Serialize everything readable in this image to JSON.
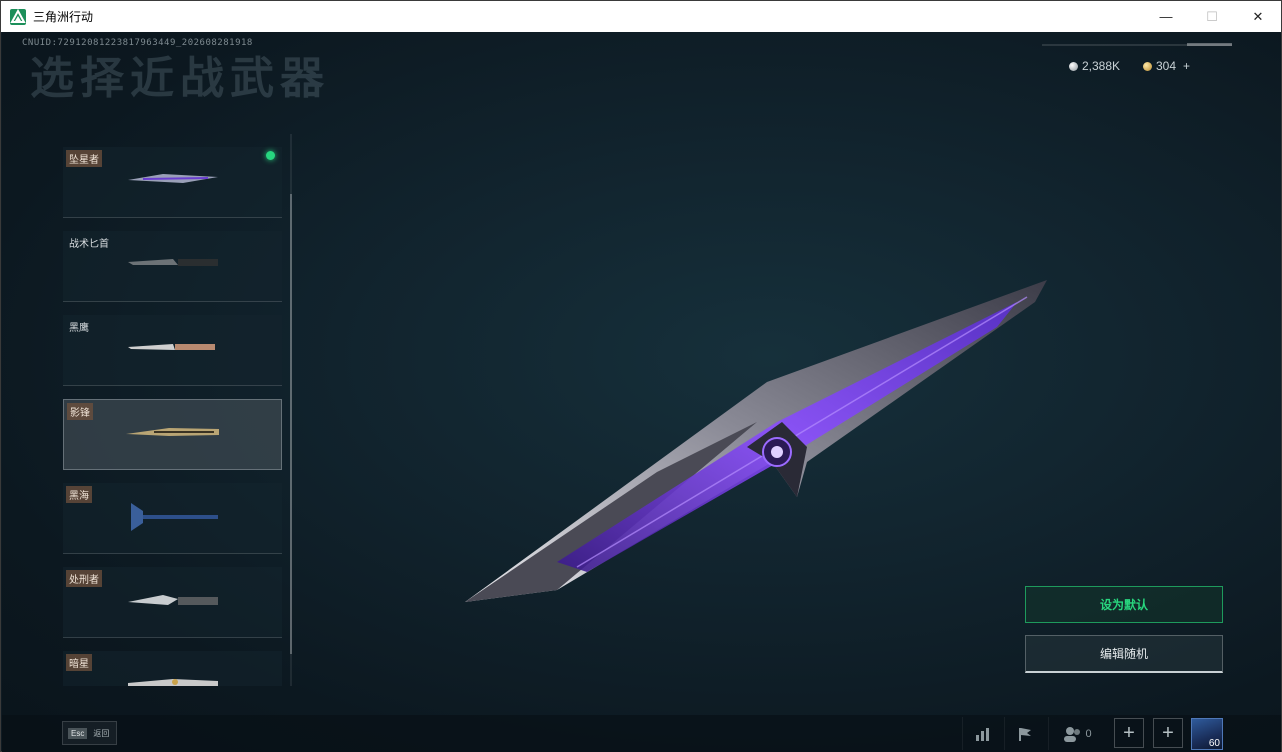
{
  "window": {
    "title": "三角洲行动",
    "controls": {
      "minimize": "—",
      "maximize": "☐",
      "close": "✕"
    }
  },
  "uid": "CNUID:7291208122381796344​9_202608281918",
  "page_title": "选择近战武器",
  "currency": {
    "silver": "2,388K",
    "gold": "304",
    "add": "+"
  },
  "weapons": [
    {
      "name": "坠星者",
      "tagged": true,
      "equipped": true,
      "selected": false,
      "icon": "knife-sleek-purple-icon"
    },
    {
      "name": "战术匕首",
      "tagged": false,
      "equipped": false,
      "selected": false,
      "icon": "tactical-knife-icon"
    },
    {
      "name": "黑鹰",
      "tagged": false,
      "equipped": false,
      "selected": false,
      "icon": "combat-knife-icon"
    },
    {
      "name": "影锋",
      "tagged": true,
      "equipped": false,
      "selected": true,
      "icon": "gold-blade-icon"
    },
    {
      "name": "黑海",
      "tagged": true,
      "equipped": false,
      "selected": false,
      "icon": "axe-icon"
    },
    {
      "name": "处刑者",
      "tagged": true,
      "equipped": false,
      "selected": false,
      "icon": "serrated-knife-icon"
    },
    {
      "name": "暗星",
      "tagged": true,
      "equipped": false,
      "selected": false,
      "icon": "dark-star-knife-icon"
    }
  ],
  "actions": {
    "set_default": "设为默认",
    "edit_random": "编辑随机"
  },
  "bottom": {
    "esc_key": "Esc",
    "esc_label": "返回",
    "friends_count": "0",
    "plus": "+",
    "avatar_level": "60"
  },
  "colors": {
    "accent_green": "#28d67e",
    "equipped_dot": "#27d67f",
    "blade_purple": "#7a3cff"
  }
}
